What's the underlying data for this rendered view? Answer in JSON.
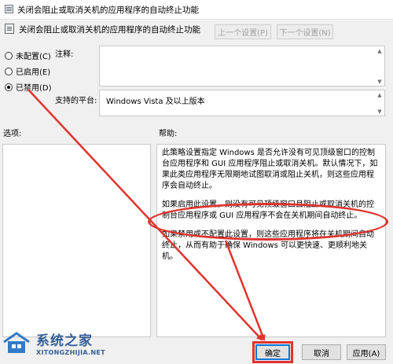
{
  "window": {
    "title": "关闭会阻止或取消关机的应用程序的自动终止功能"
  },
  "header": {
    "title": "关闭会阻止或取消关机的应用程序的自动终止功能"
  },
  "nav": {
    "prev_label": "上一个设置(P)",
    "next_label": "下一个设置(N)"
  },
  "state_options": [
    {
      "label": "未配置(C)",
      "checked": false
    },
    {
      "label": "已启用(E)",
      "checked": false
    },
    {
      "label": "已禁用(D)",
      "checked": true
    }
  ],
  "comment": {
    "label": "注释:",
    "value": ""
  },
  "platform": {
    "label": "支持的平台:",
    "value": "Windows Vista 及以上版本"
  },
  "options": {
    "label": "选项:"
  },
  "help": {
    "label": "帮助:",
    "para1": "此策略设置指定 Windows 是否允许没有可见顶级窗口的控制台应用程序和 GUI 应用程序阻止或取消关机。默认情况下，如果此类应用程序无限期地试图取消或阻止关机，则这些应用程序会自动终止。",
    "para2": "如果启用此设置，则没有可见顶级窗口且阻止或取消关机的控制台应用程序或 GUI 应用程序不会在关机期间自动终止。",
    "para3": "如果禁用或不配置此设置，则这些应用程序将在关机期间自动终止，从而有助于确保 Windows 可以更快速、更顺利地关机。"
  },
  "buttons": {
    "ok_label": "确定",
    "cancel_label": "取消",
    "apply_label": "应用(A)"
  },
  "watermark": {
    "brand": "系统之家",
    "url": "XITONGZHIJIA.NET"
  },
  "annotation_color": "#e0342f",
  "scroll_icons": {
    "up": "chevron-up-icon",
    "down": "chevron-down-icon"
  }
}
